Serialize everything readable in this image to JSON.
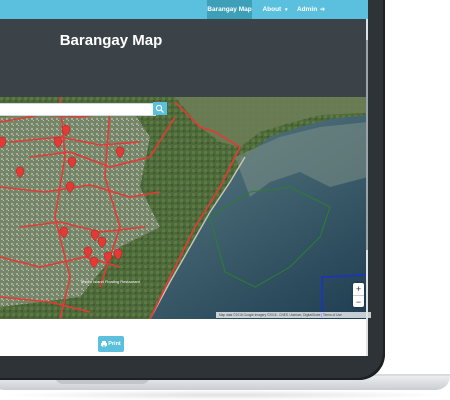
{
  "nav": {
    "items": [
      {
        "label": "Barangay Map"
      },
      {
        "label": "About",
        "caret": "▾"
      },
      {
        "label": "Admin",
        "icon": "➜"
      }
    ]
  },
  "header": {
    "title": "Barangay Map"
  },
  "map": {
    "search": {
      "placeholder": "",
      "button_icon": "search-icon"
    },
    "zoom": {
      "in": "+",
      "out": "−"
    },
    "place_label": "Tesoro Island Floating Restaurant",
    "attribution": "Map data ©2016 Google Imagery ©2016 , CNES / Astrium, DigitalGlobe | Terms of Use"
  },
  "footer": {
    "print_label": "Print",
    "print_icon": "print-icon"
  },
  "colors": {
    "accent": "#5bc0de",
    "accent_dark": "#3e9fb8",
    "header_bg": "#3c4348",
    "boundary": "#e53935",
    "marker": "#e53935",
    "water_boundary_green": "#2e7d32",
    "water_boundary_blue": "#1a2fd6"
  }
}
